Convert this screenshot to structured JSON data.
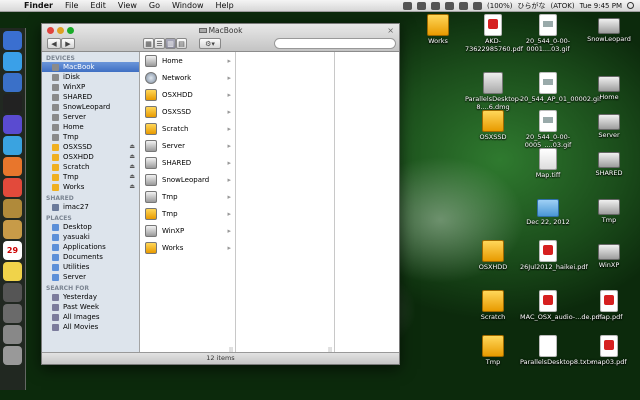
{
  "menubar": {
    "apple": "",
    "menus": [
      "Finder",
      "File",
      "Edit",
      "View",
      "Go",
      "Window",
      "Help"
    ],
    "battery": "(100%)",
    "input": "ひらがな",
    "ime": "(ATOK)",
    "clock": "Tue 9:45 PM"
  },
  "dock": {
    "items": [
      "finder-icon",
      "app-store-icon",
      "itunes-icon",
      "terminal-icon",
      "app-icon",
      "mail-icon",
      "firefox-icon",
      "chrome-icon",
      "photos-icon",
      "contacts-icon",
      "calendar-icon",
      "notes-icon",
      "calculator-icon",
      "utility-icon",
      "system-preferences-icon",
      "trash-icon"
    ],
    "colors": [
      "#3a6fd0",
      "#3aa0e8",
      "#3a70c8",
      "#222222",
      "#5a4bd0",
      "#3aa3e0",
      "#e8762c",
      "#e24a3b",
      "#b08a3a",
      "#c79b48",
      "#ffffff",
      "#f0d34a",
      "#555555",
      "#6a6a6a",
      "#888888",
      "#999999"
    ],
    "calendar_day": "29"
  },
  "finder": {
    "title": "MacBook",
    "nav": {
      "back": "◀",
      "forward": "▶"
    },
    "views": [
      "▦",
      "☰",
      "▥",
      "▤"
    ],
    "action": "⚙▾",
    "search_placeholder": "",
    "sidebar": {
      "devices_title": "DEVICES",
      "devices": [
        {
          "label": "MacBook",
          "selected": true,
          "eject": false
        },
        {
          "label": "iDisk",
          "eject": false
        },
        {
          "label": "WinXP",
          "eject": false
        },
        {
          "label": "SHARED",
          "eject": false
        },
        {
          "label": "SnowLeopard",
          "eject": false
        },
        {
          "label": "Server",
          "eject": false
        },
        {
          "label": "Home",
          "eject": false
        },
        {
          "label": "Tmp",
          "eject": false
        },
        {
          "label": "OSXSSD",
          "eject": true
        },
        {
          "label": "OSXHDD",
          "eject": true
        },
        {
          "label": "Scratch",
          "eject": true
        },
        {
          "label": "Tmp",
          "eject": true
        },
        {
          "label": "Works",
          "eject": true
        }
      ],
      "shared_title": "SHARED",
      "shared": [
        {
          "label": "imac27"
        }
      ],
      "places_title": "PLACES",
      "places": [
        {
          "label": "Desktop"
        },
        {
          "label": "yasuaki"
        },
        {
          "label": "Applications"
        },
        {
          "label": "Documents"
        },
        {
          "label": "Utilities"
        },
        {
          "label": "Server"
        }
      ],
      "search_title": "SEARCH FOR",
      "searches": [
        {
          "label": "Yesterday"
        },
        {
          "label": "Past Week"
        },
        {
          "label": "All Images"
        },
        {
          "label": "All Movies"
        }
      ]
    },
    "column1": [
      {
        "label": "Home",
        "kind": "drive"
      },
      {
        "label": "Network",
        "kind": "network"
      },
      {
        "label": "OSXHDD",
        "kind": "orange"
      },
      {
        "label": "OSXSSD",
        "kind": "orange"
      },
      {
        "label": "Scratch",
        "kind": "orange"
      },
      {
        "label": "Server",
        "kind": "drive"
      },
      {
        "label": "SHARED",
        "kind": "drive"
      },
      {
        "label": "SnowLeopard",
        "kind": "drive"
      },
      {
        "label": "Tmp",
        "kind": "drive"
      },
      {
        "label": "Tmp",
        "kind": "orange"
      },
      {
        "label": "WinXP",
        "kind": "drive"
      },
      {
        "label": "Works",
        "kind": "orange"
      }
    ],
    "status": "12 items"
  },
  "desktop": [
    {
      "label": "Works",
      "kind": "orange"
    },
    {
      "label": "AKD-73622985760.pdf",
      "kind": "pdf"
    },
    {
      "label": "20_544_0-00-0001....03.gif",
      "kind": "gif"
    },
    {
      "label": "SnowLeopard",
      "kind": "drive"
    },
    {
      "label": "ParallelsDesktop-8....6.dmg",
      "kind": "dmg"
    },
    {
      "label": "20_544_AP_01_00002.gif",
      "kind": "gif"
    },
    {
      "label": "Home",
      "kind": "drive"
    },
    {
      "label": "OSXSSD",
      "kind": "orange"
    },
    {
      "label": "20_544_0-00-0005_....03.gif",
      "kind": "gif"
    },
    {
      "label": "Server",
      "kind": "drive"
    },
    {
      "label": "Map.tiff",
      "kind": "tiff"
    },
    {
      "label": "SHARED",
      "kind": "drive"
    },
    {
      "label": "Dec 22, 2012",
      "kind": "folder"
    },
    {
      "label": "Tmp",
      "kind": "drive"
    },
    {
      "label": "OSXHDD",
      "kind": "orange"
    },
    {
      "label": "26Jul2012_haikei.pdf",
      "kind": "pdf"
    },
    {
      "label": "WinXP",
      "kind": "drive"
    },
    {
      "label": "Scratch",
      "kind": "orange"
    },
    {
      "label": "MAC_OSX_audio-...de.pdf",
      "kind": "pdf"
    },
    {
      "label": "map.pdf",
      "kind": "pdf"
    },
    {
      "label": "Tmp",
      "kind": "orange"
    },
    {
      "label": "ParallelsDesktop8.txtx",
      "kind": "doc"
    },
    {
      "label": "map03.pdf",
      "kind": "pdf"
    }
  ]
}
